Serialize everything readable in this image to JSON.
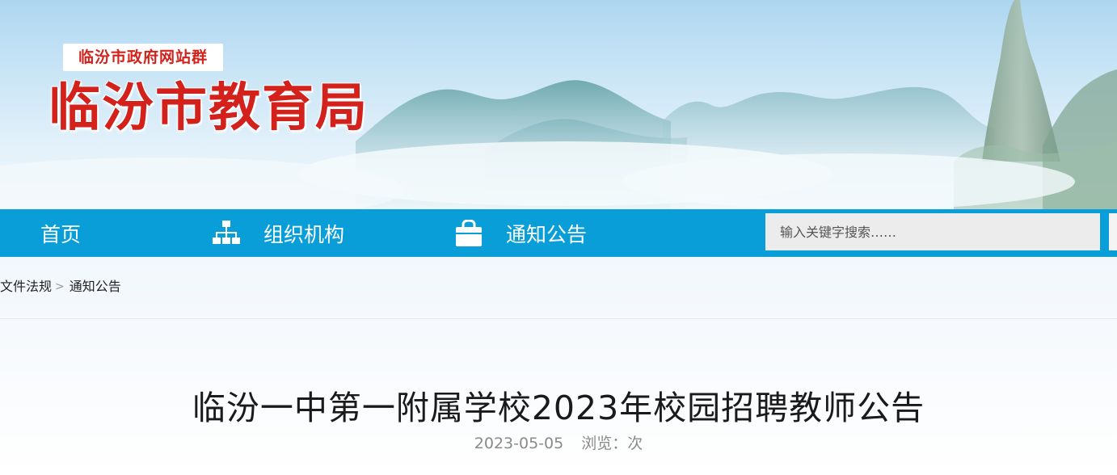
{
  "header": {
    "site_group": "临汾市政府网站群",
    "site_title": "临汾市教育局"
  },
  "nav": {
    "items": [
      {
        "label": "首页",
        "icon": "home"
      },
      {
        "label": "组织机构",
        "icon": "org-chart-icon"
      },
      {
        "label": "通知公告",
        "icon": "bag-icon"
      }
    ],
    "search_placeholder": "输入关键字搜索……"
  },
  "breadcrumb": {
    "items": [
      "文件法规",
      "通知公告"
    ],
    "separator": ">"
  },
  "article": {
    "title": "临汾一中第一附属学校2023年校园招聘教师公告",
    "date": "2023-05-05",
    "views_label": "浏览：次"
  },
  "colors": {
    "brand_red": "#d3211b",
    "nav_blue": "#0a9ed8"
  }
}
